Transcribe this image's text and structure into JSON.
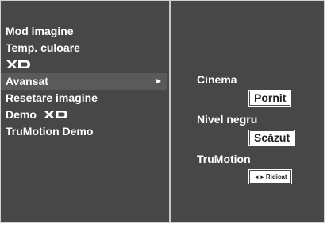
{
  "menu": {
    "items": [
      {
        "label": "Mod imagine"
      },
      {
        "label": "Temp. culoare"
      },
      {
        "label": "XD",
        "logo": true
      },
      {
        "label": "Avansat",
        "selected": true,
        "arrow": "►"
      },
      {
        "label": "Resetare imagine"
      },
      {
        "label": "Demo"
      },
      {
        "label": "TruMotion Demo"
      }
    ]
  },
  "submenu": {
    "cinema_label": "Cinema",
    "cinema_value": "Pornit",
    "black_level_label": "Nivel negru",
    "black_level_value": "Scăzut",
    "trumotion_label": "TruMotion",
    "trumotion_arrows": "◄►",
    "trumotion_value": "Ridicat"
  },
  "colors": {
    "background": "#474747",
    "selected": "#5a5a5a",
    "text": "#ffffff",
    "divider": "#c8c8c8"
  }
}
